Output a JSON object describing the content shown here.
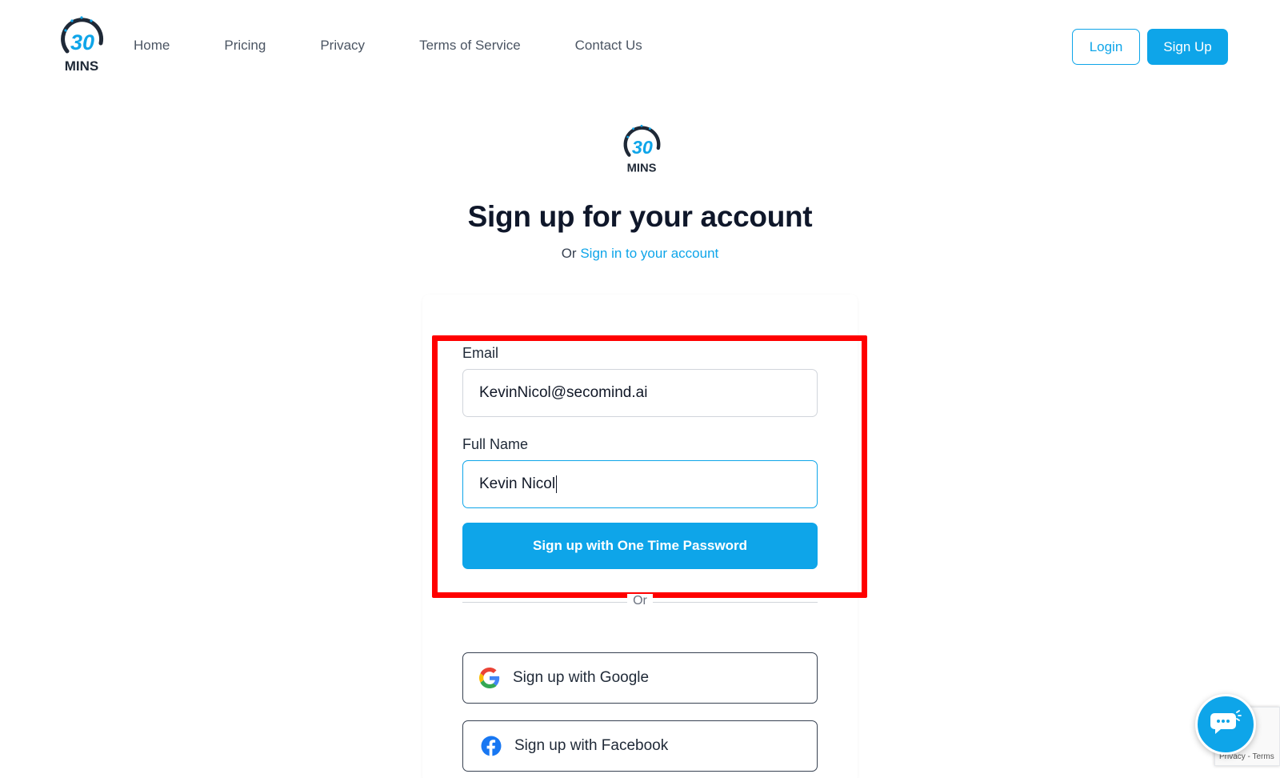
{
  "brand": {
    "logo_number": "30",
    "logo_text": "MINS"
  },
  "nav": {
    "items": [
      {
        "label": "Home"
      },
      {
        "label": "Pricing"
      },
      {
        "label": "Privacy"
      },
      {
        "label": "Terms of Service"
      },
      {
        "label": "Contact Us"
      }
    ],
    "login_label": "Login",
    "signup_label": "Sign Up"
  },
  "page": {
    "title": "Sign up for your account",
    "subtitle_prefix": "Or",
    "subtitle_link": "Sign in to your account"
  },
  "form": {
    "email_label": "Email",
    "email_value": "KevinNicol@secomind.ai",
    "name_label": "Full Name",
    "name_value": "Kevin Nicol",
    "otp_button": "Sign up with One Time Password",
    "divider_text": "Or",
    "google_button": "Sign up with Google",
    "facebook_button": "Sign up with Facebook"
  },
  "recaptcha": {
    "text": "Privacy - Terms"
  },
  "colors": {
    "accent": "#0ea5e9",
    "highlight": "#ff0000",
    "facebook": "#1877f2"
  },
  "icons": {
    "chat": "chat-bubble-icon",
    "google": "google-icon",
    "facebook": "facebook-icon"
  }
}
